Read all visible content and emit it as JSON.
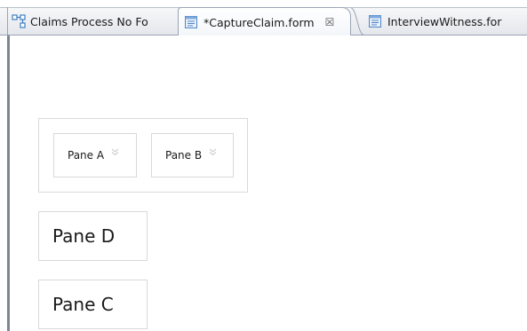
{
  "tabs": [
    {
      "label": "Claims Process No Fo",
      "icon": "process-icon"
    },
    {
      "label": "*CaptureClaim.form",
      "icon": "form-icon",
      "close": "☒"
    },
    {
      "label": "InterviewWitness.for",
      "icon": "form-icon"
    }
  ],
  "form": {
    "pane_a": "Pane A",
    "pane_b": "Pane B",
    "pane_d": "Pane D",
    "pane_c": "Pane C"
  },
  "colors": {
    "tab_border": "#9aa5b4",
    "pane_border": "#d9d9d9",
    "editor_left_border": "#7d8695"
  }
}
